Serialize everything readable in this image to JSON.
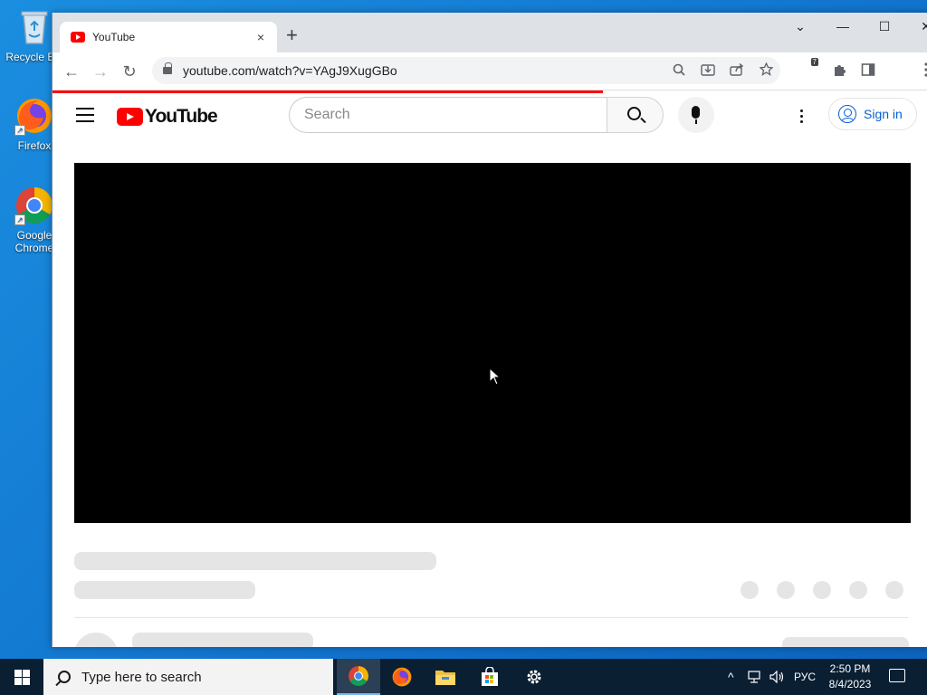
{
  "desktop": {
    "icons": [
      {
        "label": "Recycle Bin",
        "icon": "recycle-bin-icon"
      },
      {
        "label": "Firefox",
        "icon": "firefox-icon"
      },
      {
        "label": "Google Chrome",
        "icon": "chrome-icon"
      }
    ]
  },
  "browser": {
    "tab": {
      "title": "YouTube",
      "close_glyph": "×"
    },
    "new_tab_glyph": "+",
    "window_controls": {
      "tab_search": "⌄",
      "minimize": "—",
      "maximize": "☐",
      "close": "✕"
    },
    "toolbar": {
      "back_glyph": "←",
      "forward_glyph": "→",
      "reload_glyph": "↻",
      "url": "youtube.com/watch?v=YAgJ9XugGBo",
      "ublock_badge": "7"
    },
    "load_progress": 0.62
  },
  "youtube": {
    "logo_text": "YouTube",
    "search": {
      "placeholder": "Search"
    },
    "signin_label": "Sign in"
  },
  "taskbar": {
    "search_placeholder": "Type here to search",
    "apps": [
      {
        "name": "chrome",
        "active": true
      },
      {
        "name": "firefox",
        "active": false
      },
      {
        "name": "file-explorer",
        "active": false
      },
      {
        "name": "microsoft-store",
        "active": false
      },
      {
        "name": "settings",
        "active": false
      }
    ],
    "tray": {
      "chevron": "^",
      "language": "РУС"
    },
    "clock": {
      "time": "2:50 PM",
      "date": "8/4/2023"
    }
  },
  "colors": {
    "youtube_red": "#ff0000",
    "link_blue": "#065fd4",
    "taskbar": "#0b1f33"
  }
}
